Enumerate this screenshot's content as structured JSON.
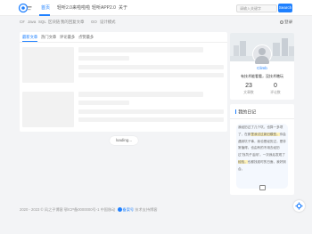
{
  "header": {
    "nav": [
      {
        "label": "首页",
        "active": true
      },
      {
        "label": "轻听2.0来啦啦啦",
        "active": false
      },
      {
        "label": "轻听APP2.0",
        "active": false
      },
      {
        "label": "关于",
        "active": false
      }
    ],
    "search_placeholder": "请输入关键字",
    "search_button": "Search"
  },
  "subnav": {
    "items": [
      "C#",
      "Java",
      "SQL",
      "区块链",
      "我的回复文章",
      "GO",
      "设计模式"
    ],
    "login_label": "登录"
  },
  "main": {
    "tabs": [
      "最新文章",
      "热门文章",
      "评论最多",
      "点赞最多"
    ],
    "loading_label": "loading..."
  },
  "profile": {
    "name": "Climb",
    "bio": "有技术能看看，没技术瞎玩",
    "stats": [
      {
        "value": "23",
        "label": "文章数"
      },
      {
        "value": "0",
        "label": "评论数"
      }
    ]
  },
  "diary": {
    "title": "我的日记",
    "segments": [
      {
        "text": "我经历过了几个坑，也算一多项了，在那",
        "hl": false
      },
      {
        "text": "里我试过新旧模型。",
        "hl": true
      },
      {
        "text": "你会遇到坑子事，我也是经历过，是非常值得。也由有的不用去经历过\"找坑子活用\"。一次我后发现了",
        "hl": false
      },
      {
        "text": "",
        "hl": false
      },
      {
        "text": "经验，",
        "hl": true
      },
      {
        "text": "也都找准时的日面，我好到合。",
        "hl": false
      }
    ]
  },
  "footer": {
    "copyright": "2020 - 2023 © 风之子博客 鄂ICP备0000000号-1 中国移动",
    "link": "备案号",
    "extra": "技术支持博客"
  },
  "colors": {
    "accent": "#1e80ff",
    "background": "#f3f4f6"
  }
}
